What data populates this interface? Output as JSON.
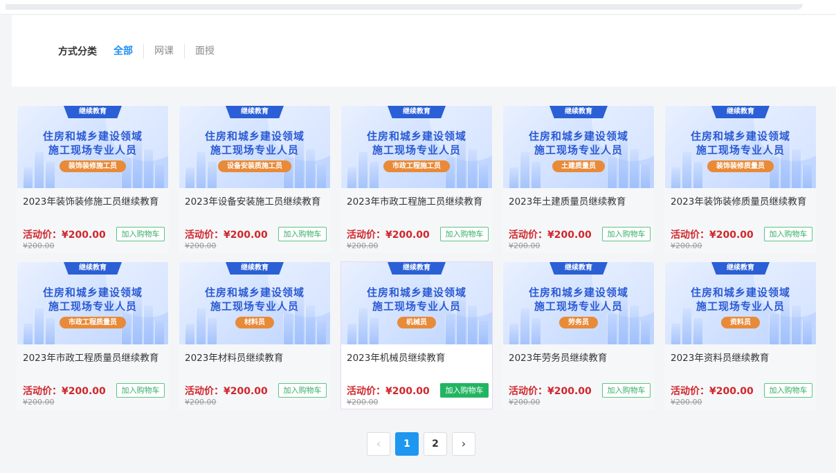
{
  "filter": {
    "label": "方式分类",
    "options": [
      "全部",
      "网课",
      "面授"
    ],
    "active": 0
  },
  "courses": [
    {
      "category": "继续教育",
      "banner_line1": "住房和城乡建设领域",
      "banner_line2": "施工现场专业人员",
      "role": "装饰装修施工员",
      "title": "2023年装饰装修施工员继续教育",
      "price_label": "活动价：¥200.00",
      "original_price": "¥200.00",
      "cart_label": "加入购物车"
    },
    {
      "category": "继续教育",
      "banner_line1": "住房和城乡建设领域",
      "banner_line2": "施工现场专业人员",
      "role": "设备安装质施工员",
      "title": "2023年设备安装施工员继续教育",
      "price_label": "活动价：¥200.00",
      "original_price": "¥200.00",
      "cart_label": "加入购物车"
    },
    {
      "category": "继续教育",
      "banner_line1": "住房和城乡建设领域",
      "banner_line2": "施工现场专业人员",
      "role": "市政工程施工员",
      "title": "2023年市政工程施工员继续教育",
      "price_label": "活动价：¥200.00",
      "original_price": "¥200.00",
      "cart_label": "加入购物车"
    },
    {
      "category": "继续教育",
      "banner_line1": "住房和城乡建设领域",
      "banner_line2": "施工现场专业人员",
      "role": "土建质量员",
      "title": "2023年土建质量员继续教育",
      "price_label": "活动价：¥200.00",
      "original_price": "¥200.00",
      "cart_label": "加入购物车"
    },
    {
      "category": "继续教育",
      "banner_line1": "住房和城乡建设领域",
      "banner_line2": "施工现场专业人员",
      "role": "装饰装修质量员",
      "title": "2023年装饰装修质量员继续教育",
      "price_label": "活动价：¥200.00",
      "original_price": "¥200.00",
      "cart_label": "加入购物车"
    },
    {
      "category": "继续教育",
      "banner_line1": "住房和城乡建设领域",
      "banner_line2": "施工现场专业人员",
      "role": "市政工程质量员",
      "title": "2023年市政工程质量员继续教育",
      "price_label": "活动价：¥200.00",
      "original_price": "¥200.00",
      "cart_label": "加入购物车"
    },
    {
      "category": "继续教育",
      "banner_line1": "住房和城乡建设领域",
      "banner_line2": "施工现场专业人员",
      "role": "材料员",
      "title": "2023年材料员继续教育",
      "price_label": "活动价：¥200.00",
      "original_price": "¥200.00",
      "cart_label": "加入购物车"
    },
    {
      "category": "继续教育",
      "banner_line1": "住房和城乡建设领域",
      "banner_line2": "施工现场专业人员",
      "role": "机械员",
      "title": "2023年机械员继续教育",
      "price_label": "活动价：¥200.00",
      "original_price": "¥200.00",
      "cart_label": "加入购物车"
    },
    {
      "category": "继续教育",
      "banner_line1": "住房和城乡建设领域",
      "banner_line2": "施工现场专业人员",
      "role": "劳务员",
      "title": "2023年劳务员继续教育",
      "price_label": "活动价：¥200.00",
      "original_price": "¥200.00",
      "cart_label": "加入购物车"
    },
    {
      "category": "继续教育",
      "banner_line1": "住房和城乡建设领域",
      "banner_line2": "施工现场专业人员",
      "role": "资料员",
      "title": "2023年资料员继续教育",
      "price_label": "活动价：¥200.00",
      "original_price": "¥200.00",
      "cart_label": "加入购物车"
    }
  ],
  "pagination": {
    "prev_icon": "chevron-left-icon",
    "next_icon": "chevron-right-icon",
    "pages": [
      "1",
      "2"
    ],
    "current": "1"
  },
  "colors": {
    "accent_blue": "#1e8ef0",
    "price_red": "#d0272c",
    "cart_green": "#22b561",
    "banner_tag_blue": "#2a5fd6",
    "banner_pill_orange": "#e88a38"
  }
}
